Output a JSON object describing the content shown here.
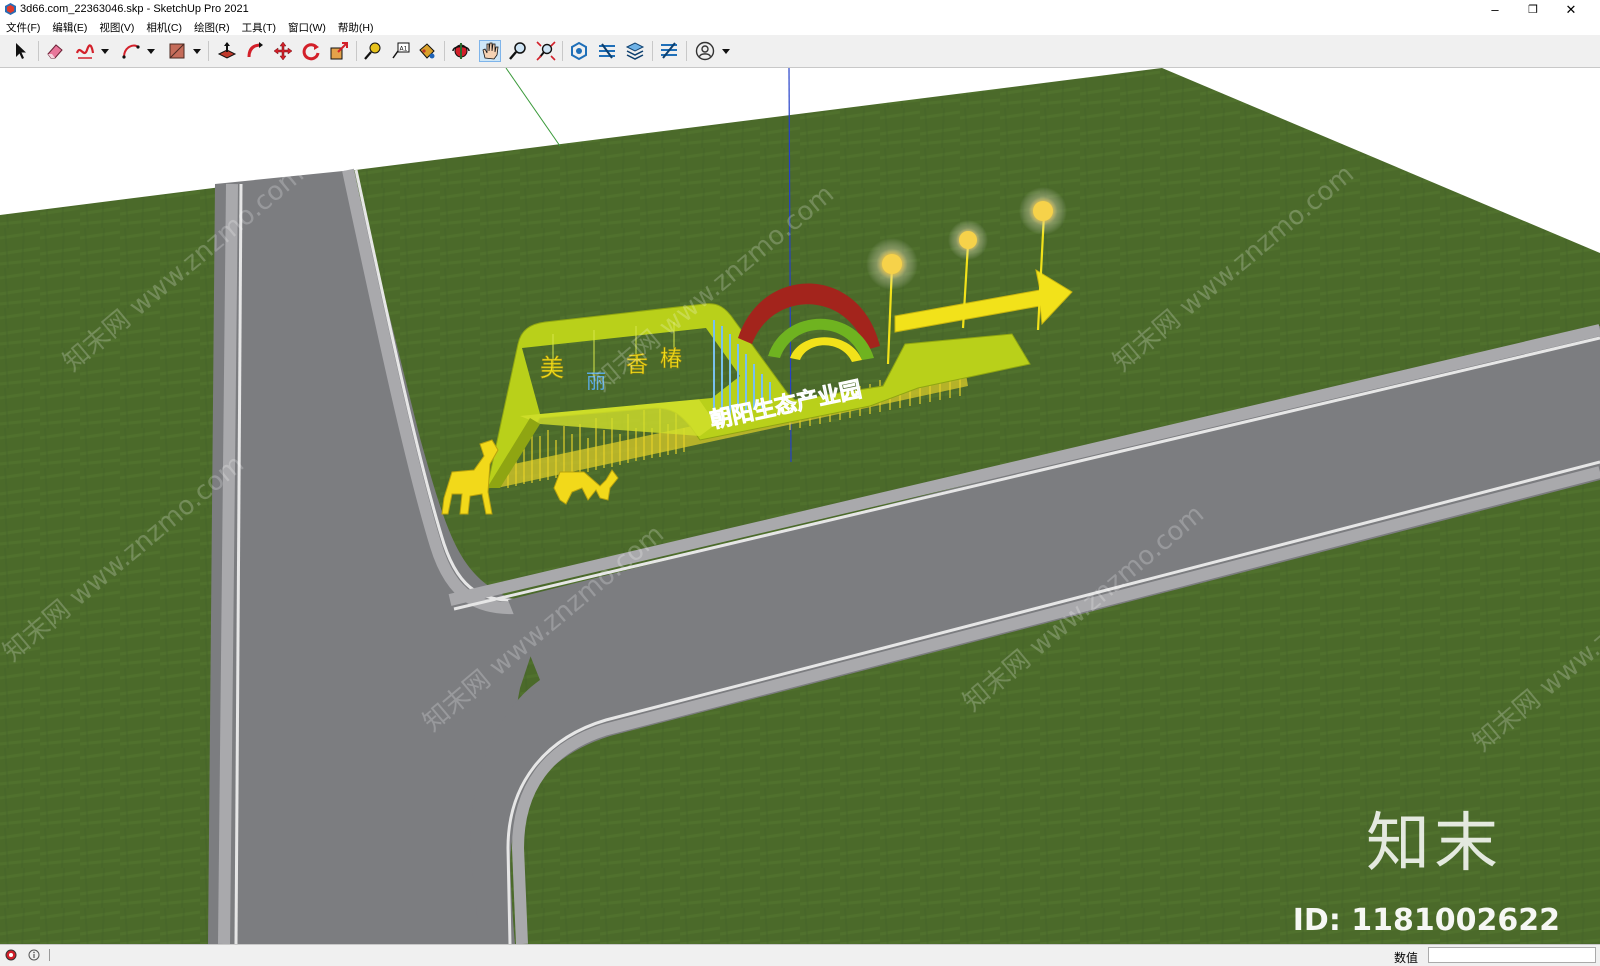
{
  "window": {
    "title": "3d66.com_22363046.skp - SketchUp Pro 2021",
    "minimize_glyph": "–",
    "restore_glyph": "❐",
    "close_glyph": "✕"
  },
  "menu": [
    {
      "label": "文件(F)"
    },
    {
      "label": "编辑(E)"
    },
    {
      "label": "视图(V)"
    },
    {
      "label": "相机(C)"
    },
    {
      "label": "绘图(R)"
    },
    {
      "label": "工具(T)"
    },
    {
      "label": "窗口(W)"
    },
    {
      "label": "帮助(H)"
    }
  ],
  "toolbar": {
    "tools": [
      "select-icon",
      "eraser-icon",
      "freehand-icon",
      "arc-icon",
      "shape-icon",
      "pushpull-icon",
      "followme-icon",
      "move-icon",
      "rotate-icon",
      "scale-icon",
      "tape-icon",
      "text-icon",
      "paint-icon",
      "orbit-icon",
      "pan-icon",
      "zoom-icon",
      "zoom-extents-icon",
      "warehouse-icon",
      "extension-icon",
      "layers-icon",
      "component-icon",
      "account-icon"
    ],
    "active_tool": "pan-icon"
  },
  "scene": {
    "sign_title": "美 丽 香 椿",
    "sign_title_chars": [
      "美",
      "丽",
      "香",
      "椿"
    ],
    "sign_subtitle": "朝阳生态产业园",
    "colors": {
      "grass": "#4b6a2a",
      "road": "#7c7d80",
      "road_line": "#e6e6e6",
      "sign_green": "#b7d31e",
      "sign_yellow": "#f2e21a",
      "arch_red": "#a3241c",
      "arch_green": "#6fb320",
      "text_blue": "#6aaedf"
    }
  },
  "watermark": {
    "text": "知末网 www.znzmo.com",
    "brand": "知末",
    "model_id": "ID: 1181002622"
  },
  "status": {
    "measure_label": "数值",
    "measure_value": ""
  }
}
